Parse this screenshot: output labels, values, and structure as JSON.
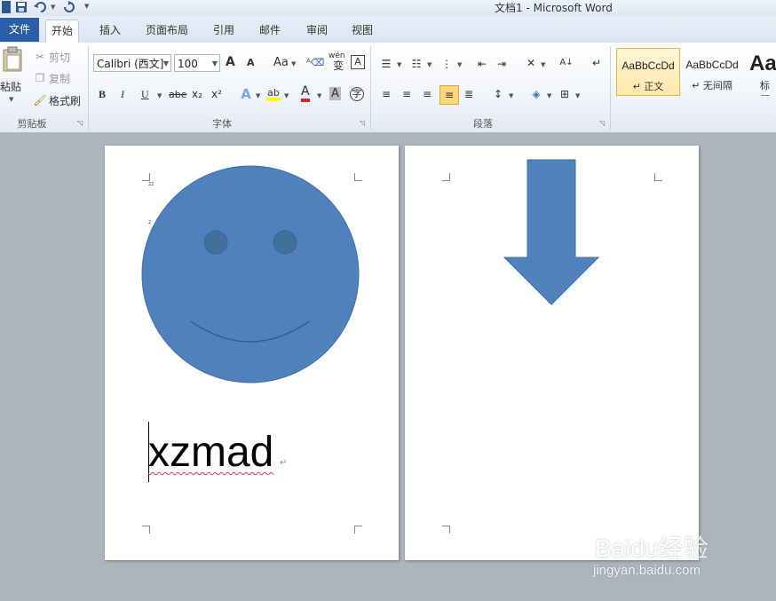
{
  "window": {
    "title": "文档1 - Microsoft Word"
  },
  "quick_access": {
    "save_icon": "save-icon",
    "undo_icon": "undo-icon",
    "redo_icon": "redo-icon",
    "customize_icon": "customize-icon"
  },
  "tabs": {
    "file": "文件",
    "items": [
      "开始",
      "插入",
      "页面布局",
      "引用",
      "邮件",
      "审阅",
      "视图"
    ],
    "active": "开始"
  },
  "clipboard": {
    "paste": "粘贴",
    "cut": "剪切",
    "copy": "复制",
    "format_painter": "格式刷",
    "label": "剪贴板"
  },
  "font": {
    "name": "Calibri (西文]",
    "size": "100",
    "grow": "A",
    "shrink": "A",
    "change_case": "Aa",
    "bold": "B",
    "italic": "I",
    "underline": "U",
    "strike": "abe",
    "subscript": "x₂",
    "superscript": "x²",
    "font_color": "A",
    "char_shading": "A",
    "enclose": "字",
    "phonetic": "wén",
    "label": "字体"
  },
  "paragraph": {
    "label": "段落"
  },
  "styles": {
    "items": [
      {
        "sample": "AaBbCcDd",
        "name": "↵ 正文"
      },
      {
        "sample": "AaBbCcDd",
        "name": "↵ 无间隔"
      },
      {
        "sample": "Aa",
        "name": "标题"
      }
    ]
  },
  "document": {
    "text": "xzmad",
    "paragraph_mark": "↵",
    "small_marks": [
      "22",
      "2"
    ],
    "shape_color": "#4f81bd",
    "shape_outline": "#41709c"
  },
  "watermark": {
    "brand": "Baidu经验",
    "url": "jingyan.baidu.com"
  }
}
